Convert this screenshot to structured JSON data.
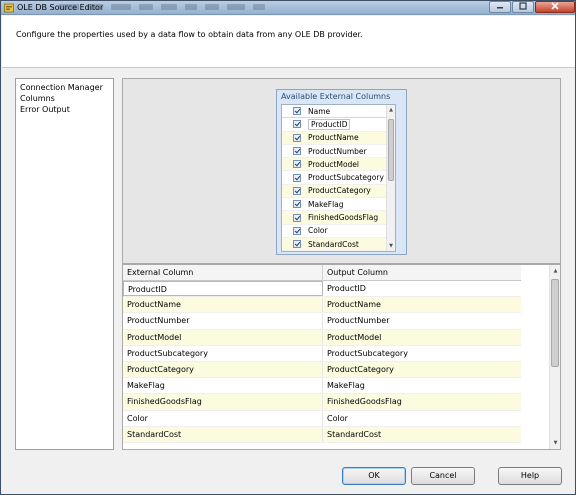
{
  "window": {
    "title": "OLE DB Source Editor"
  },
  "header": {
    "description": "Configure the properties used by a data flow to obtain data from any OLE DB provider."
  },
  "nav": {
    "items": [
      "Connection Manager",
      "Columns",
      "Error Output"
    ]
  },
  "available_columns": {
    "title": "Available External Columns",
    "header": "Name",
    "items": [
      {
        "name": "ProductID",
        "checked": true
      },
      {
        "name": "ProductName",
        "checked": true
      },
      {
        "name": "ProductNumber",
        "checked": true
      },
      {
        "name": "ProductModel",
        "checked": true
      },
      {
        "name": "ProductSubcategory",
        "checked": true
      },
      {
        "name": "ProductCategory",
        "checked": true
      },
      {
        "name": "MakeFlag",
        "checked": true
      },
      {
        "name": "FinishedGoodsFlag",
        "checked": true
      },
      {
        "name": "Color",
        "checked": true
      },
      {
        "name": "StandardCost",
        "checked": true
      }
    ]
  },
  "mapping_grid": {
    "columns": [
      "External Column",
      "Output Column"
    ],
    "rows": [
      [
        "ProductID",
        "ProductID"
      ],
      [
        "ProductName",
        "ProductName"
      ],
      [
        "ProductNumber",
        "ProductNumber"
      ],
      [
        "ProductModel",
        "ProductModel"
      ],
      [
        "ProductSubcategory",
        "ProductSubcategory"
      ],
      [
        "ProductCategory",
        "ProductCategory"
      ],
      [
        "MakeFlag",
        "MakeFlag"
      ],
      [
        "FinishedGoodsFlag",
        "FinishedGoodsFlag"
      ],
      [
        "Color",
        "Color"
      ],
      [
        "StandardCost",
        "StandardCost"
      ]
    ]
  },
  "buttons": {
    "ok": "OK",
    "cancel": "Cancel",
    "help": "Help"
  },
  "icons": {
    "window": "ssis-source-icon",
    "minimize": "minimize-icon",
    "maximize": "maximize-icon",
    "close": "close-icon"
  },
  "colors": {
    "alt_row": "#fcfbe0",
    "ext_box_bg": "#d9e6f5",
    "default_button_border": "#3b7bbf"
  }
}
